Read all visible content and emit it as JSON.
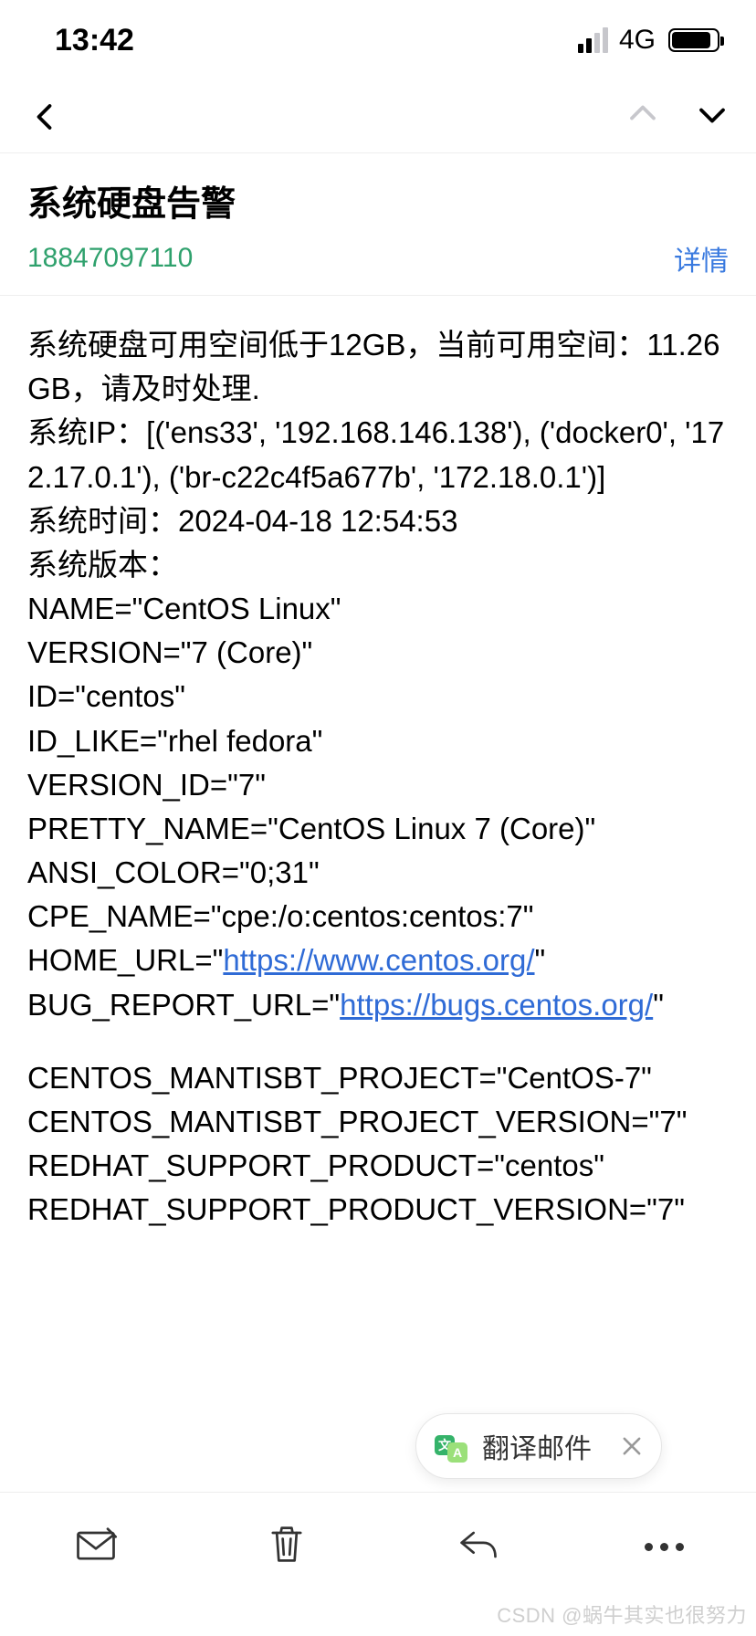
{
  "status": {
    "time": "13:42",
    "network": "4G"
  },
  "header": {
    "title": "系统硬盘告警",
    "sender": "18847097110",
    "detail": "详情"
  },
  "body": {
    "l1": "系统硬盘可用空间低于12GB，当前可用空间：11.26GB，请及时处理.",
    "l2": "系统IP：[('ens33', '192.168.146.138'), ('docker0', '172.17.0.1'), ('br-c22c4f5a677b', '172.18.0.1')]",
    "l3": "系统时间：2024-04-18 12:54:53",
    "l4": "系统版本：",
    "l5": "NAME=\"CentOS Linux\"",
    "l6": "VERSION=\"7 (Core)\"",
    "l7": "ID=\"centos\"",
    "l8": "ID_LIKE=\"rhel fedora\"",
    "l9": "VERSION_ID=\"7\"",
    "l10": "PRETTY_NAME=\"CentOS Linux 7 (Core)\"",
    "l11": "ANSI_COLOR=\"0;31\"",
    "l12": "CPE_NAME=\"cpe:/o:centos:centos:7\"",
    "home_url_prefix": "HOME_URL=\"",
    "home_url": "https://www.centos.org/",
    "home_url_suffix": "\"",
    "bug_url_prefix": "BUG_REPORT_URL=\"",
    "bug_url": "https://bugs.centos.org/",
    "bug_url_suffix": "\"",
    "l15": "CENTOS_MANTISBT_PROJECT=\"CentOS-7\"",
    "l16": "CENTOS_MANTISBT_PROJECT_VERSION=\"7\"",
    "l17": "REDHAT_SUPPORT_PRODUCT=\"centos\"",
    "l18": "REDHAT_SUPPORT_PRODUCT_VERSION=\"7\""
  },
  "translate": {
    "label": "翻译邮件"
  },
  "watermark": "CSDN @蜗牛其实也很努力"
}
